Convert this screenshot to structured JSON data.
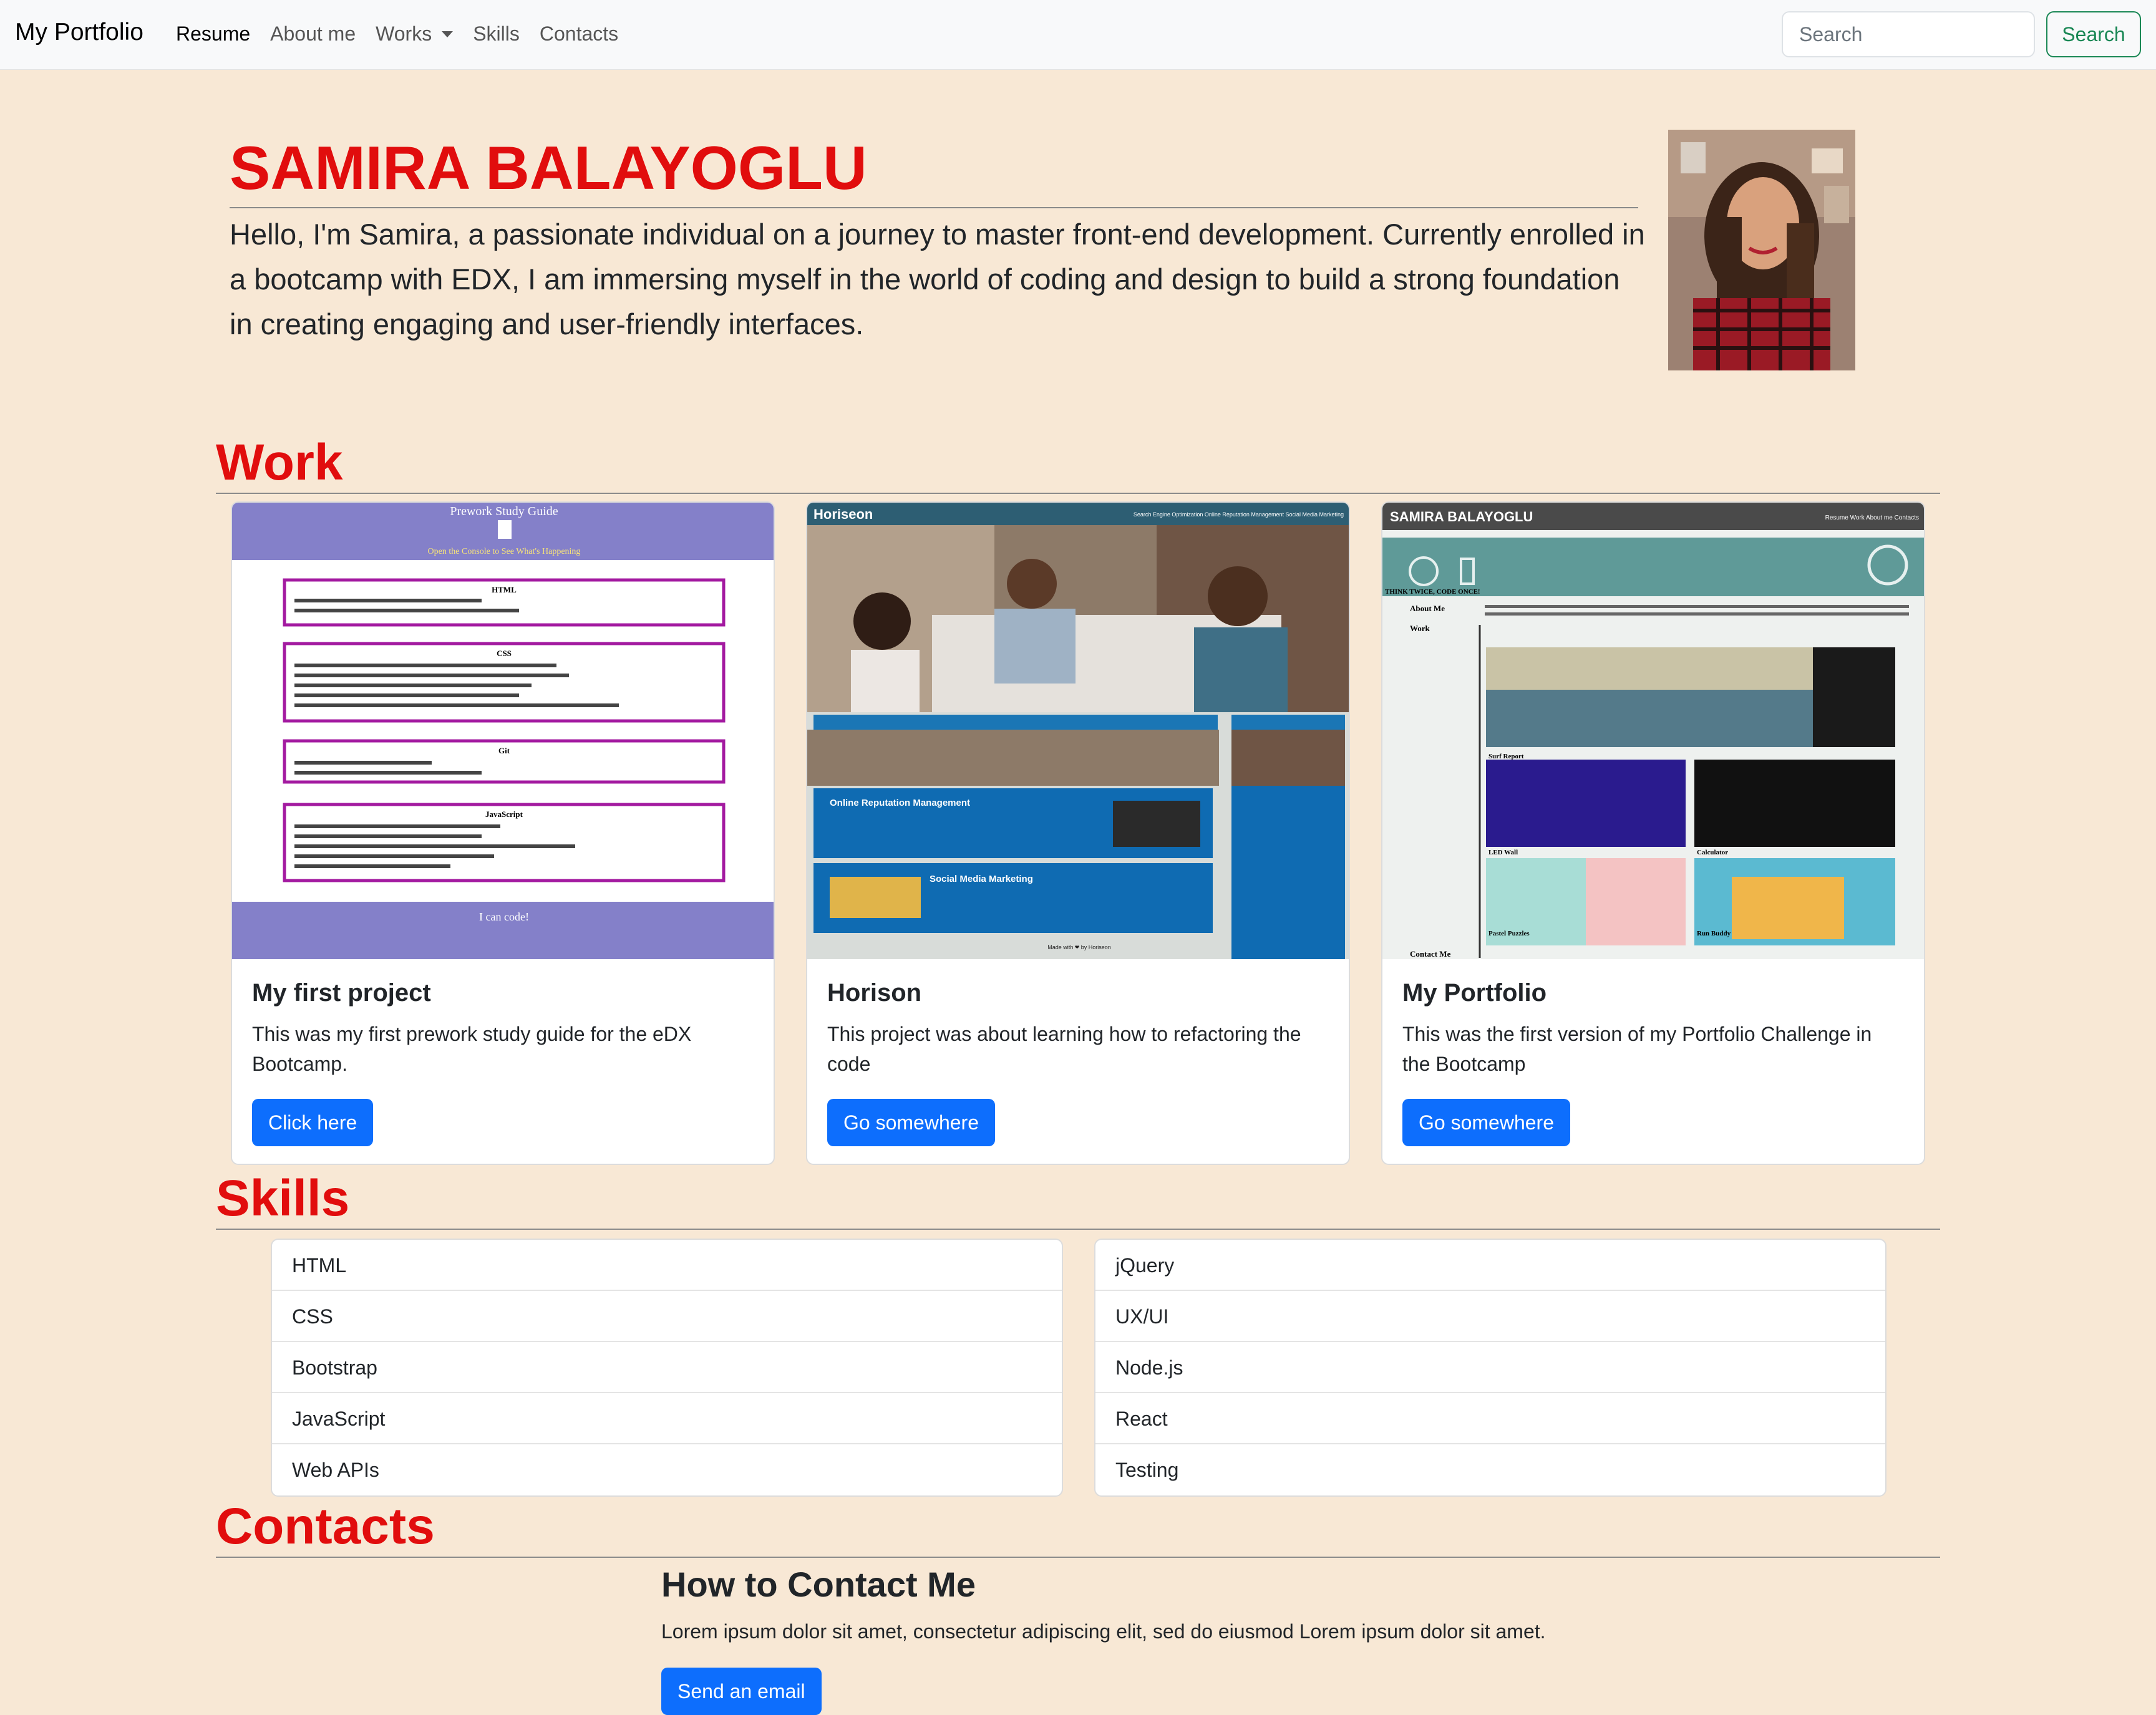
{
  "navbar": {
    "brand": "My Portfolio",
    "links": [
      "Resume",
      "About me",
      "Works",
      "Skills",
      "Contacts"
    ],
    "search_placeholder": "Search",
    "search_button": "Search"
  },
  "hero": {
    "name": "SAMIRA BALAYOGLU",
    "intro": "Hello, I'm Samira, a passionate individual on a journey to master front-end development. Currently enrolled in a bootcamp with EDX, I am immersing myself in the world of coding and design to build a strong foundation in creating engaging and user-friendly interfaces."
  },
  "work": {
    "title": "Work",
    "cards": [
      {
        "title": "My first project",
        "text": "This was my first prework study guide for the eDX Bootcamp.",
        "button": "Click here",
        "thumb": {
          "heading": "Prework Study Guide",
          "subheading": "Open the Console to See What's Happening",
          "sections": [
            "HTML",
            "CSS",
            "Git",
            "JavaScript"
          ],
          "footer": "I can code!"
        }
      },
      {
        "title": "Horison",
        "text": "This project was about learning how to refactoring the code",
        "button": "Go somewhere",
        "thumb": {
          "logo": "Horiseon",
          "nav": "Search Engine Optimization    Online Reputation Management    Social Media Marketing",
          "panel1": "Online Reputation Management",
          "panel2": "Social Media Marketing",
          "footer": "Made with ❤ by Horiseon"
        }
      },
      {
        "title": "My Portfolio",
        "text": "This was the first version of my Portfolio Challenge in the Bootcamp",
        "button": "Go somewhere",
        "thumb": {
          "header": "SAMIRA BALAYOGLU",
          "nav": "Resume   Work   About me   Contacts",
          "tagline": "THINK TWICE, CODE ONCE!",
          "about": "About Me",
          "work": "Work",
          "contact": "Contact Me",
          "tiles": [
            "Surf Report",
            "LED Wall",
            "Calculator",
            "Pastel Puzzles",
            "Run Buddy"
          ]
        }
      }
    ]
  },
  "skills": {
    "title": "Skills",
    "left": [
      "HTML",
      "CSS",
      "Bootstrap",
      "JavaScript",
      "Web APIs"
    ],
    "right": [
      "jQuery",
      "UX/UI",
      "Node.js",
      "React",
      "Testing"
    ]
  },
  "contacts": {
    "title": "Contacts",
    "heading": "How to Contact Me",
    "text": "Lorem ipsum dolor sit amet, consectetur adipiscing elit, sed do eiusmod Lorem ipsum dolor sit amet.",
    "button": "Send an email"
  },
  "colors": {
    "page_bg": "#f8e8d5",
    "accent_red": "#e10d0d",
    "primary_blue": "#0d6efd",
    "success_green": "#198754"
  }
}
